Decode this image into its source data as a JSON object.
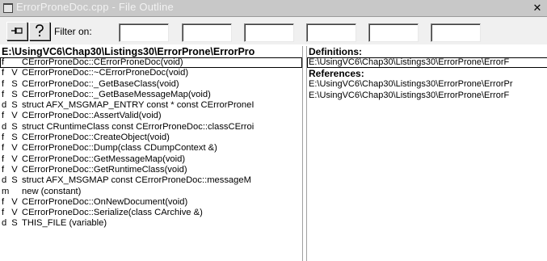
{
  "window": {
    "title": "ErrorProneDoc.cpp - File Outline",
    "close_glyph": "✕"
  },
  "toolbar": {
    "pin_icon": "pin-icon",
    "help_icon": "help-icon",
    "filter_label": "Filter on:",
    "filters": [
      "",
      "",
      "",
      "",
      "",
      ""
    ]
  },
  "outline": {
    "path": "E:\\UsingVC6\\Chap30\\Listings30\\ErrorProne\\ErrorPro",
    "items": [
      {
        "kind": "f",
        "mod": "",
        "name": "CErrorProneDoc::CErrorProneDoc(void)",
        "selected": true
      },
      {
        "kind": "f",
        "mod": "V",
        "name": "CErrorProneDoc::~CErrorProneDoc(void)"
      },
      {
        "kind": "f",
        "mod": "S",
        "name": "CErrorProneDoc::_GetBaseClass(void)"
      },
      {
        "kind": "f",
        "mod": "S",
        "name": "CErrorProneDoc::_GetBaseMessageMap(void)"
      },
      {
        "kind": "d",
        "mod": "S",
        "name": "struct AFX_MSGMAP_ENTRY const * const CErrorProneI"
      },
      {
        "kind": "f",
        "mod": "V",
        "name": "CErrorProneDoc::AssertValid(void)"
      },
      {
        "kind": "d",
        "mod": "S",
        "name": "struct CRuntimeClass const CErrorProneDoc::classCErroi"
      },
      {
        "kind": "f",
        "mod": "S",
        "name": "CErrorProneDoc::CreateObject(void)"
      },
      {
        "kind": "f",
        "mod": "V",
        "name": "CErrorProneDoc::Dump(class CDumpContext &)"
      },
      {
        "kind": "f",
        "mod": "V",
        "name": "CErrorProneDoc::GetMessageMap(void)"
      },
      {
        "kind": "f",
        "mod": "V",
        "name": "CErrorProneDoc::GetRuntimeClass(void)"
      },
      {
        "kind": "d",
        "mod": "S",
        "name": "struct AFX_MSGMAP const CErrorProneDoc::messageM"
      },
      {
        "kind": "m",
        "mod": "",
        "name": "new (constant)"
      },
      {
        "kind": "f",
        "mod": "V",
        "name": "CErrorProneDoc::OnNewDocument(void)"
      },
      {
        "kind": "f",
        "mod": "V",
        "name": "CErrorProneDoc::Serialize(class CArchive &)"
      },
      {
        "kind": "d",
        "mod": "S",
        "name": "THIS_FILE (variable)"
      }
    ]
  },
  "details": {
    "definitions_label": "Definitions:",
    "definitions": [
      "E:\\UsingVC6\\Chap30\\Listings30\\ErrorProne\\ErrorF"
    ],
    "references_label": "References:",
    "references": [
      "E:\\UsingVC6\\Chap30\\Listings30\\ErrorProne\\ErrorPr",
      "E:\\UsingVC6\\Chap30\\Listings30\\ErrorProne\\ErrorF"
    ]
  }
}
